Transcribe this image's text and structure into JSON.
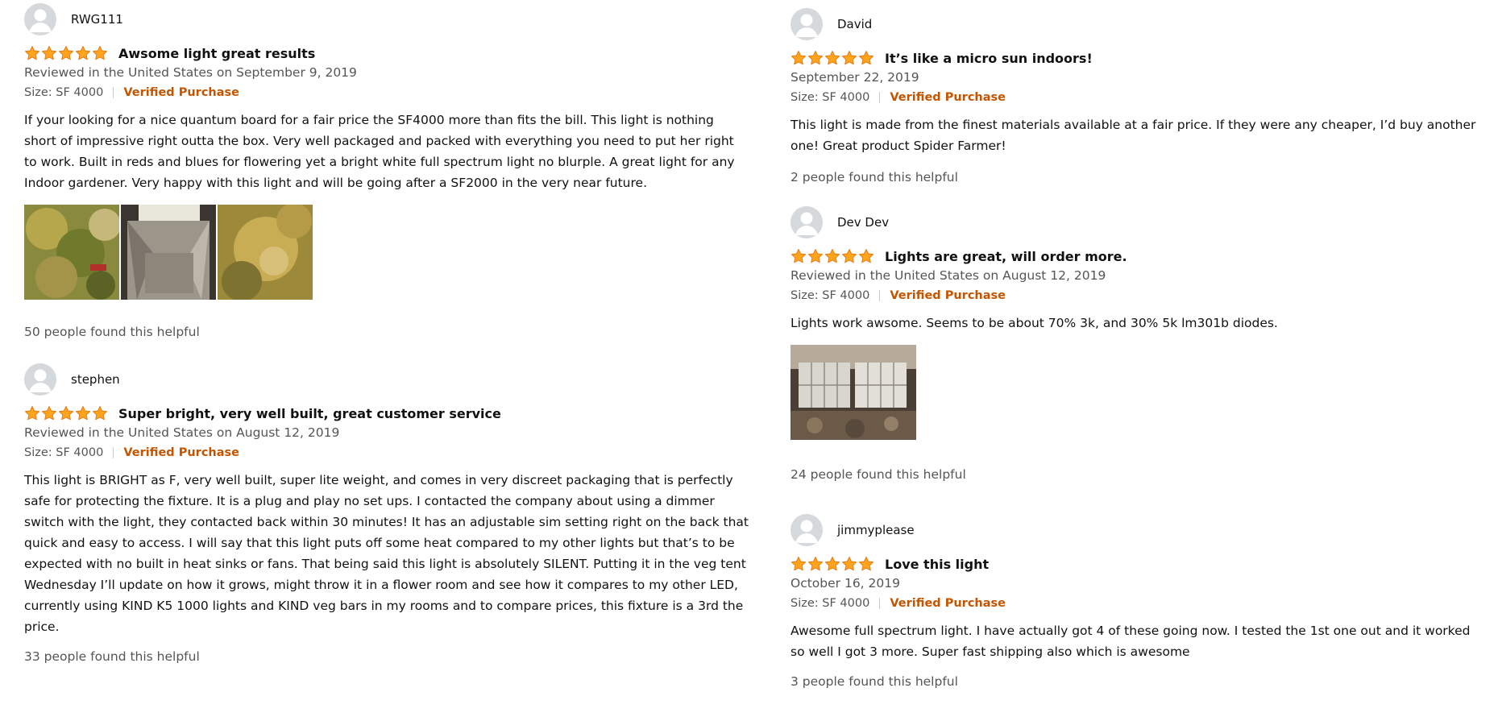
{
  "colors": {
    "star": "#FFA41C",
    "star_stroke": "#E47911",
    "verified": "#C45500",
    "meta_text": "#555555",
    "avatar_bg": "#D6D9DC"
  },
  "icons": {
    "avatar": "default-user-silhouette",
    "star": "filled-star"
  },
  "reviews_left": [
    {
      "username": "RWG111",
      "rating": 5,
      "title": "Awsome light great results",
      "date": "Reviewed in the United States on September 9, 2019",
      "size": "Size: SF 4000",
      "verified": "Verified Purchase",
      "body": "If your looking for a nice quantum board for a fair price the SF4000 more than fits the bill. This light is nothing short of impressive right outta the box. Very well packaged and packed with everything you need to put her right to work. Built in reds and blues for flowering yet a bright white full spectrum light no blurple. A great light for any Indoor gardener. Very happy with this light and will be going after a SF2000 in the very near future.",
      "images": [
        "cannabis-bud-photo",
        "grow-tent-with-light-photo",
        "cannabis-bud-closeup-photo"
      ],
      "helpful": "50 people found this helpful"
    },
    {
      "username": "stephen",
      "rating": 5,
      "title": "Super bright, very well built, great customer service",
      "date": "Reviewed in the United States on August 12, 2019",
      "size": "Size: SF 4000",
      "verified": "Verified Purchase",
      "body": "This light is BRIGHT as F, very well built, super lite weight, and comes in very discreet packaging that is perfectly safe for protecting the fixture. It is a plug and play no set ups. I contacted the company about using a dimmer switch with the light, they contacted back within 30 minutes! It has an adjustable sim setting right on the back that quick and easy to access. I will say that this light puts off some heat compared to my other lights but that’s to be expected with no built in heat sinks or fans. That being said this light is absolutely SILENT. Putting it in the veg tent Wednesday I’ll update on how it grows, might throw it in a flower room and see how it compares to my other LED, currently using KIND K5 1000 lights and KIND veg bars in my rooms and to compare prices, this fixture is a 3rd the price.",
      "helpful": "33 people found this helpful"
    }
  ],
  "reviews_right": [
    {
      "username": "David",
      "rating": 5,
      "title": "It’s like a micro sun indoors!",
      "date": "September 22, 2019",
      "size": "Size: SF 4000",
      "verified": "Verified Purchase",
      "body": "This light is made from the finest materials available at a fair price. If they were any cheaper, I’d buy another one! Great product Spider Farmer!",
      "helpful": "2 people found this helpful"
    },
    {
      "username": "Dev Dev",
      "rating": 5,
      "title": "Lights are great, will order more.",
      "date": "Reviewed in the United States on August 12, 2019",
      "size": "Size: SF 4000",
      "verified": "Verified Purchase",
      "body": "Lights work awsome. Seems to be about 70% 3k, and 30% 5k lm301b diodes.",
      "images": [
        "led-grow-lights-photo"
      ],
      "helpful": "24 people found this helpful"
    },
    {
      "username": "jimmyplease",
      "rating": 5,
      "title": "Love this light",
      "date": "October 16, 2019",
      "size": "Size: SF 4000",
      "verified": "Verified Purchase",
      "body": "Awesome full spectrum light. I have actually got 4 of these going now. I tested the 1st one out and it worked so well I got 3 more. Super fast shipping also which is awesome",
      "helpful": "3 people found this helpful"
    }
  ]
}
